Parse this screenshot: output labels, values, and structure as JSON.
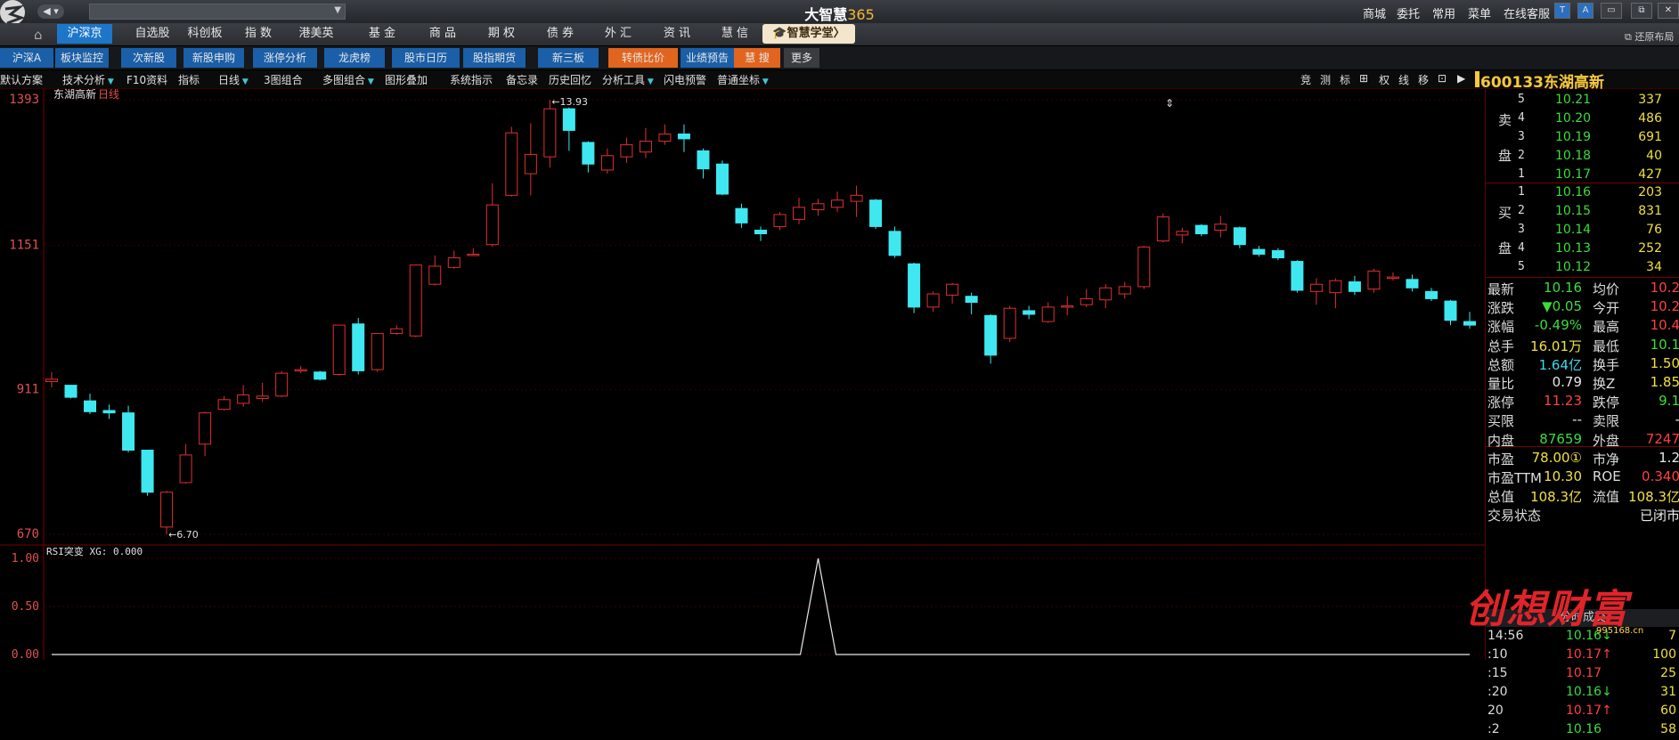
{
  "titlebar": {
    "back": "◀",
    "app_title_text": "大智慧",
    "app_title_num": "365",
    "menus": [
      "商城",
      "委托",
      "常用",
      "菜单",
      "在线客服"
    ],
    "window_buttons": [
      "T",
      "A",
      "▭",
      "⧉",
      "✕"
    ]
  },
  "market_tabs": [
    {
      "label": "沪深京",
      "selected": true
    },
    {
      "label": "自选股"
    },
    {
      "label": "科创板"
    },
    {
      "label": "指  数"
    },
    {
      "label": "港美英"
    },
    {
      "label": "基  金"
    },
    {
      "label": "商  品"
    },
    {
      "label": "期  权"
    },
    {
      "label": "债  券"
    },
    {
      "label": "外  汇"
    },
    {
      "label": "资  讯"
    },
    {
      "label": "慧  信"
    }
  ],
  "school_button": "🎓智慧学堂〉",
  "restore_layout": "还原布局",
  "sub_tabs": [
    {
      "label": "沪深A",
      "style": "blue"
    },
    {
      "label": "板块监控",
      "style": "blue"
    },
    {
      "label": "次新股",
      "style": "blue"
    },
    {
      "label": "新股申购",
      "style": "blue"
    },
    {
      "label": "涨停分析",
      "style": "blue"
    },
    {
      "label": "龙虎榜",
      "style": "blue"
    },
    {
      "label": "股市日历",
      "style": "blue"
    },
    {
      "label": "股指期货",
      "style": "blue"
    },
    {
      "label": "新三板",
      "style": "blue"
    },
    {
      "label": "转债比价",
      "style": "orange"
    },
    {
      "label": "业绩预告",
      "style": "blue"
    },
    {
      "label": "慧  搜",
      "style": "orange"
    },
    {
      "label": "更多",
      "style": "gray"
    }
  ],
  "toolbar": [
    "默认方案",
    "技术分析",
    "F10资料",
    "指标",
    "日线",
    "3图组合",
    "多图组合",
    "图形叠加",
    "系统指示",
    "备忘录",
    "历史回忆",
    "分析工具",
    "闪电预警",
    "普通坐标"
  ],
  "right_tools": [
    "竞",
    "测",
    "标",
    "⊞",
    "权",
    "线",
    "移",
    "⊡",
    "▶"
  ],
  "stock": {
    "code": "600133",
    "name": "东湖高新"
  },
  "chart_header": {
    "name": "东湖高新",
    "period": "日线"
  },
  "indicator_header": "RSI突变  XG: 0.000",
  "sell_label": [
    "卖",
    "盘"
  ],
  "buy_label": [
    "买",
    "盘"
  ],
  "sell_orders": [
    {
      "level": "5",
      "price": "10.21",
      "volume": "337"
    },
    {
      "level": "4",
      "price": "10.20",
      "volume": "486"
    },
    {
      "level": "3",
      "price": "10.19",
      "volume": "691"
    },
    {
      "level": "2",
      "price": "10.18",
      "volume": "40"
    },
    {
      "level": "1",
      "price": "10.17",
      "volume": "427"
    }
  ],
  "buy_orders": [
    {
      "level": "1",
      "price": "10.16",
      "volume": "203"
    },
    {
      "level": "2",
      "price": "10.15",
      "volume": "831"
    },
    {
      "level": "3",
      "price": "10.14",
      "volume": "76"
    },
    {
      "level": "4",
      "price": "10.13",
      "volume": "252"
    },
    {
      "level": "5",
      "price": "10.12",
      "volume": "34"
    }
  ],
  "quote": [
    {
      "l1": "最新",
      "v1": "10.16",
      "c1": "green",
      "l2": "均价",
      "v2": "10.2",
      "c2": "red"
    },
    {
      "l1": "涨跌",
      "v1": "▼0.05",
      "c1": "green",
      "l2": "今开",
      "v2": "10.2",
      "c2": "red"
    },
    {
      "l1": "涨幅",
      "v1": "-0.49%",
      "c1": "green",
      "l2": "最高",
      "v2": "10.4",
      "c2": "red"
    },
    {
      "l1": "总手",
      "v1": "16.01万",
      "c1": "yellow",
      "l2": "最低",
      "v2": "10.1",
      "c2": "green"
    },
    {
      "l1": "总额",
      "v1": "1.64亿",
      "c1": "cyan",
      "l2": "换手",
      "v2": "1.50",
      "c2": "yellow"
    },
    {
      "l1": "量比",
      "v1": "0.79",
      "c1": "white",
      "l2": "换Z",
      "v2": "1.85",
      "c2": "yellow"
    },
    {
      "l1": "涨停",
      "v1": "11.23",
      "c1": "red",
      "l2": "跌停",
      "v2": "9.1",
      "c2": "green"
    },
    {
      "l1": "买限",
      "v1": "--",
      "c1": "white",
      "l2": "卖限",
      "v2": "-",
      "c2": "white"
    },
    {
      "l1": "内盘",
      "v1": "87659",
      "c1": "green",
      "l2": "外盘",
      "v2": "7247",
      "c2": "red"
    },
    {
      "l1": "市盈",
      "v1": "78.00①",
      "c1": "yellow",
      "l2": "市净",
      "v2": "1.2",
      "c2": "white"
    },
    {
      "l1": "市盈TTM",
      "v1": "10.30",
      "c1": "yellow",
      "l2": "ROE",
      "v2": "0.340",
      "c2": "red"
    },
    {
      "l1": "总值",
      "v1": "108.3亿",
      "c1": "yellow",
      "l2": "流值",
      "v2": "108.3亿",
      "c2": "yellow"
    },
    {
      "l1": "交易状态",
      "v1": "",
      "c1": "white",
      "l2": "",
      "v2": "已闭市",
      "c2": "white"
    }
  ],
  "trades_header": "分时成交",
  "trades": [
    {
      "time": "14:56",
      "price": "10.16↓",
      "color": "green",
      "vol": "7"
    },
    {
      "time": ":10",
      "price": "10.17↑",
      "color": "red",
      "vol": "100"
    },
    {
      "time": ":15",
      "price": "10.17",
      "color": "red",
      "vol": "25"
    },
    {
      "time": ":20",
      "price": "10.16↓",
      "color": "green",
      "vol": "31"
    },
    {
      "time": "20",
      "price": "10.17↑",
      "color": "red",
      "vol": "60"
    },
    {
      "time": ":2",
      "price": "10.16",
      "color": "green",
      "vol": "58"
    }
  ],
  "watermark": "创想财富",
  "watermark_url": "995168.cn",
  "chart_data": [
    {
      "type": "candlestick",
      "title": "东湖高新 日线",
      "ylim": [
        6.7,
        13.93
      ],
      "y_ticks": [
        "13.93",
        "11.51",
        "9.11",
        "6.70"
      ],
      "annotations": [
        {
          "label": "13.93",
          "at": "high"
        },
        {
          "label": "6.70",
          "at": "low"
        }
      ],
      "colors": {
        "up": "#e03030",
        "down": "#3fe8f0"
      },
      "candles": [
        [
          9.24,
          9.28,
          9.14,
          9.4
        ],
        [
          9.18,
          8.98,
          8.96,
          9.18
        ],
        [
          8.92,
          8.74,
          8.7,
          9.04
        ],
        [
          8.76,
          8.72,
          8.62,
          8.86
        ],
        [
          8.72,
          8.1,
          8.06,
          8.84
        ],
        [
          8.1,
          7.4,
          7.34,
          8.1
        ],
        [
          6.82,
          7.4,
          6.7,
          7.42
        ],
        [
          7.56,
          8.02,
          7.54,
          8.2
        ],
        [
          8.2,
          8.72,
          8.0,
          8.74
        ],
        [
          8.78,
          8.94,
          8.76,
          9.0
        ],
        [
          8.88,
          9.02,
          8.82,
          9.18
        ],
        [
          8.96,
          9.0,
          8.9,
          9.22
        ],
        [
          9.0,
          9.38,
          8.98,
          9.42
        ],
        [
          9.42,
          9.44,
          9.38,
          9.5
        ],
        [
          9.4,
          9.28,
          9.26,
          9.42
        ],
        [
          9.36,
          10.18,
          9.34,
          10.18
        ],
        [
          10.2,
          9.42,
          9.36,
          10.3
        ],
        [
          9.44,
          10.04,
          9.4,
          10.04
        ],
        [
          10.04,
          10.12,
          10.02,
          10.18
        ],
        [
          10.0,
          11.18,
          9.98,
          11.18
        ],
        [
          10.86,
          11.16,
          10.84,
          11.34
        ],
        [
          11.14,
          11.3,
          11.12,
          11.42
        ],
        [
          11.36,
          11.36,
          11.34,
          11.46
        ],
        [
          11.52,
          12.18,
          11.48,
          12.54
        ],
        [
          12.34,
          13.38,
          12.32,
          13.48
        ],
        [
          12.7,
          13.02,
          12.34,
          13.54
        ],
        [
          12.98,
          13.78,
          12.8,
          13.93
        ],
        [
          13.78,
          13.42,
          13.08,
          13.8
        ],
        [
          13.22,
          12.86,
          12.72,
          13.24
        ],
        [
          12.76,
          13.0,
          12.7,
          13.12
        ],
        [
          12.98,
          13.18,
          12.88,
          13.3
        ],
        [
          13.06,
          13.24,
          12.96,
          13.46
        ],
        [
          13.24,
          13.36,
          13.18,
          13.52
        ],
        [
          13.36,
          13.28,
          13.06,
          13.52
        ],
        [
          13.08,
          12.78,
          12.62,
          13.12
        ],
        [
          12.86,
          12.36,
          12.34,
          12.92
        ],
        [
          12.12,
          11.88,
          11.8,
          12.2
        ],
        [
          11.76,
          11.7,
          11.58,
          11.82
        ],
        [
          11.82,
          12.02,
          11.76,
          12.06
        ],
        [
          11.94,
          12.14,
          11.86,
          12.3
        ],
        [
          12.1,
          12.2,
          12.0,
          12.28
        ],
        [
          12.14,
          12.26,
          12.06,
          12.4
        ],
        [
          12.24,
          12.34,
          11.98,
          12.5
        ],
        [
          12.26,
          11.82,
          11.78,
          12.28
        ],
        [
          11.74,
          11.34,
          11.3,
          11.82
        ],
        [
          11.2,
          10.48,
          10.38,
          11.22
        ],
        [
          10.48,
          10.7,
          10.4,
          10.74
        ],
        [
          10.68,
          10.86,
          10.54,
          10.88
        ],
        [
          10.66,
          10.56,
          10.36,
          10.72
        ],
        [
          10.34,
          9.68,
          9.54,
          10.36
        ],
        [
          9.96,
          10.46,
          9.9,
          10.5
        ],
        [
          10.42,
          10.36,
          10.28,
          10.5
        ],
        [
          10.24,
          10.48,
          10.22,
          10.56
        ],
        [
          10.48,
          10.5,
          10.34,
          10.66
        ],
        [
          10.52,
          10.62,
          10.48,
          10.78
        ],
        [
          10.6,
          10.8,
          10.46,
          10.86
        ],
        [
          10.7,
          10.82,
          10.62,
          10.9
        ],
        [
          10.82,
          11.48,
          10.78,
          11.5
        ],
        [
          11.58,
          11.98,
          11.56,
          12.04
        ],
        [
          11.68,
          11.74,
          11.54,
          11.8
        ],
        [
          11.84,
          11.7,
          11.66,
          11.86
        ],
        [
          11.76,
          11.86,
          11.64,
          12.0
        ],
        [
          11.8,
          11.52,
          11.46,
          11.82
        ],
        [
          11.44,
          11.36,
          11.32,
          11.5
        ],
        [
          11.42,
          11.3,
          11.26,
          11.46
        ],
        [
          11.24,
          10.76,
          10.72,
          11.26
        ],
        [
          10.74,
          10.86,
          10.52,
          10.96
        ],
        [
          10.72,
          10.92,
          10.46,
          10.96
        ],
        [
          10.9,
          10.74,
          10.68,
          11.0
        ],
        [
          10.78,
          11.08,
          10.72,
          11.12
        ],
        [
          10.98,
          10.98,
          10.92,
          11.06
        ],
        [
          10.94,
          10.8,
          10.74,
          11.02
        ],
        [
          10.74,
          10.62,
          10.58,
          10.8
        ],
        [
          10.58,
          10.26,
          10.18,
          10.6
        ],
        [
          10.24,
          10.18,
          10.12,
          10.4
        ]
      ]
    },
    {
      "type": "line",
      "title": "RSI突变  XG: 0.000",
      "ylim": [
        0,
        1
      ],
      "y_ticks": [
        "1.00",
        "0.50",
        "0.00"
      ],
      "series": [
        {
          "values_nonzero_index": 40,
          "peak": 1.0
        }
      ]
    }
  ]
}
